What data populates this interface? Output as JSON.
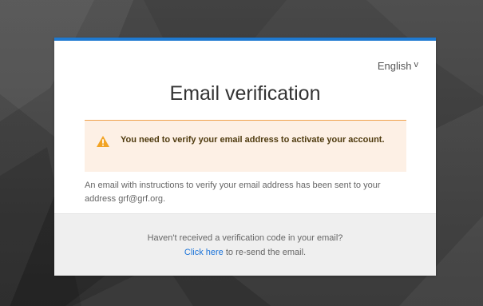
{
  "language": {
    "label": "English",
    "caret": "v"
  },
  "page": {
    "title": "Email verification"
  },
  "alert": {
    "icon": "warning-icon",
    "message": "You need to verify your email address to activate your account.",
    "colors": {
      "background": "#fdf0e5",
      "border": "#f0a24d",
      "icon": "#f2a323"
    }
  },
  "info": {
    "message": "An email with instructions to verify your email address has been sent to your address grf@grf.org."
  },
  "footer": {
    "prompt": "Haven't received a verification code in your email?",
    "link_label": "Click here",
    "suffix": " to re-send the email."
  },
  "theme": {
    "accent": "#1f7ad1"
  }
}
